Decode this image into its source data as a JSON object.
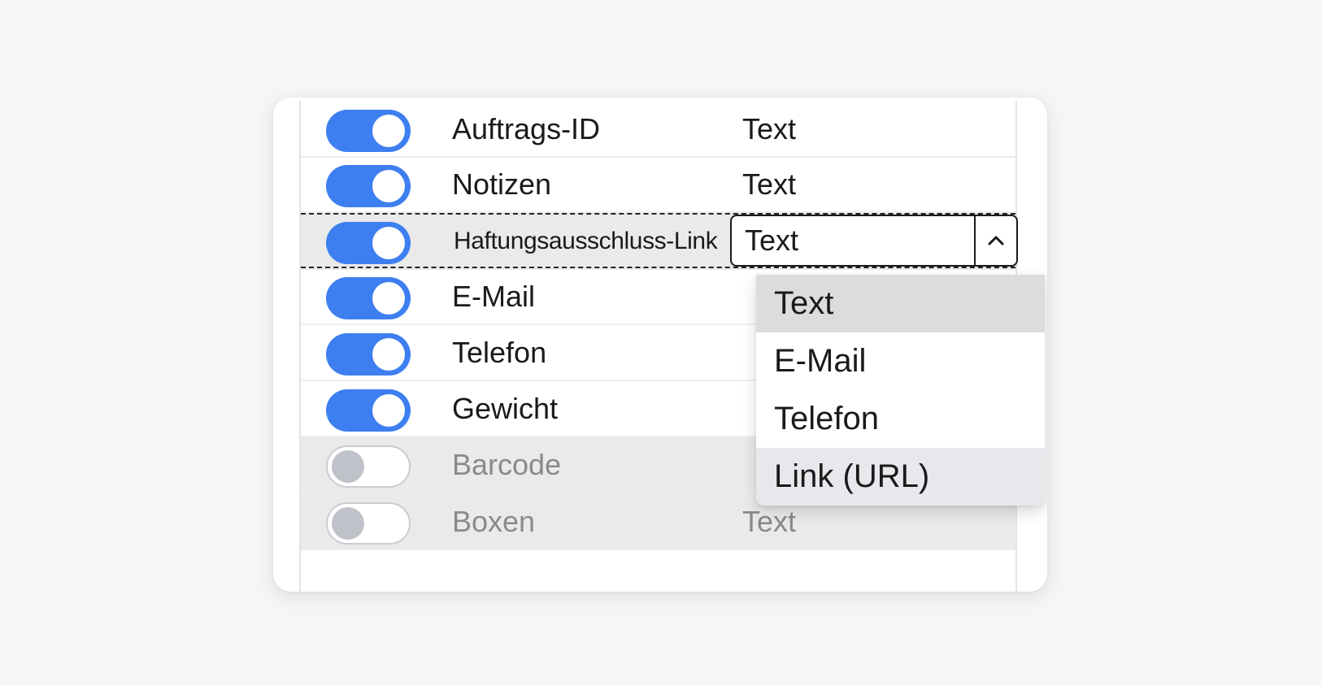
{
  "fields": [
    {
      "label": "Auftrags-ID",
      "type": "Text",
      "enabled": true
    },
    {
      "label": "Notizen",
      "type": "Text",
      "enabled": true
    },
    {
      "label": "Haftungsausschluss-Link",
      "type": "Text",
      "enabled": true,
      "editing": true
    },
    {
      "label": "E-Mail",
      "type": "",
      "enabled": true
    },
    {
      "label": "Telefon",
      "type": "",
      "enabled": true
    },
    {
      "label": "Gewicht",
      "type": "",
      "enabled": true
    },
    {
      "label": "Barcode",
      "type": "",
      "enabled": false
    },
    {
      "label": "Boxen",
      "type": "Text",
      "enabled": false
    }
  ],
  "type_select": {
    "value": "Text",
    "open": true,
    "button_icon": "chevron-up-icon",
    "options": [
      "Text",
      "E-Mail",
      "Telefon",
      "Link (URL)"
    ],
    "selected_option": "Text",
    "hovered_option": "Link (URL)"
  },
  "colors": {
    "toggle_on": "#3d7ff0",
    "toggle_off_knob": "#bfc3c9",
    "disabled_row": "#eaeaea",
    "page_background": "#f6f6f6"
  }
}
